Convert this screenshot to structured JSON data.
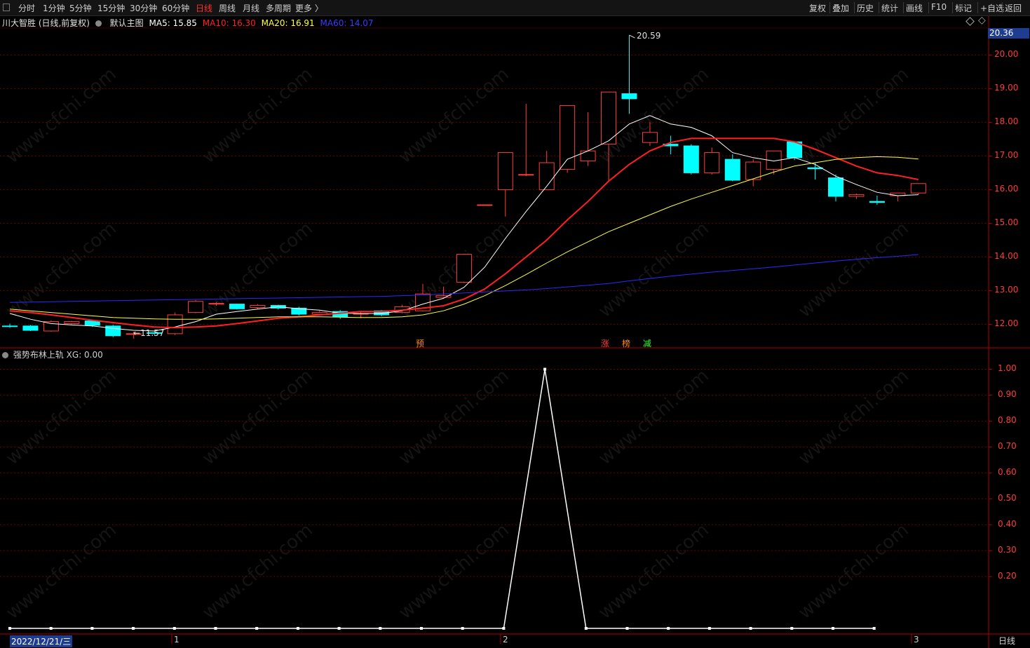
{
  "toolbar": {
    "periods": [
      "分时",
      "1分钟",
      "5分钟",
      "15分钟",
      "30分钟",
      "60分钟",
      "日线",
      "周线",
      "月线",
      "多周期",
      "更多 〉"
    ],
    "active": "日线",
    "right": [
      "复权",
      "叠加",
      "历史",
      "统计",
      "画线",
      "F10",
      "标记",
      "+自选",
      "返回"
    ]
  },
  "info": {
    "stock": "川大智胜 (日线,前复权)",
    "main_chart": "默认主图",
    "ma5": "MA5: 15.85",
    "ma10": "MA10: 16.30",
    "ma20": "MA20: 16.91",
    "ma60": "MA60: 14.07"
  },
  "indicator": {
    "name": "强势布林上轨",
    "xg": "XG: 0.00"
  },
  "price_tag": "20.36",
  "annotations": {
    "high": "20.59",
    "low": "11.57"
  },
  "tags": [
    "预",
    "涨",
    "榜",
    "减"
  ],
  "date_label": "2022/12/21/三",
  "period_label": "日线",
  "x_axis_labels": [
    "1",
    "2",
    "3"
  ],
  "watermark": "www.cfchi.com",
  "colors": {
    "up": "#ff3c3c",
    "down": "#00ffff",
    "ma5": "#ffffff",
    "ma10": "#ff2020",
    "ma20": "#ffff40",
    "ma60": "#2a2aff",
    "background": "#000000",
    "grid": "#7a0000"
  },
  "chart_data": [
    {
      "type": "candlestick",
      "title": "川大智胜 (日线,前复权)",
      "ylim": [
        11.3,
        20.8
      ],
      "yticks": [
        12.0,
        13.0,
        14.0,
        15.0,
        16.0,
        17.0,
        18.0,
        19.0,
        20.0
      ],
      "ytick_labels": [
        "12.00",
        "13.00",
        "14.00",
        "15.00",
        "16.00",
        "17.00",
        "18.00",
        "19.00",
        "20.00"
      ],
      "candles": [
        {
          "o": 11.95,
          "h": 12.02,
          "l": 11.9,
          "c": 11.93
        },
        {
          "o": 11.95,
          "h": 11.98,
          "l": 11.8,
          "c": 11.82
        },
        {
          "o": 11.8,
          "h": 12.12,
          "l": 11.78,
          "c": 12.08
        },
        {
          "o": 12.02,
          "h": 12.1,
          "l": 12.0,
          "c": 12.08
        },
        {
          "o": 12.1,
          "h": 12.12,
          "l": 11.92,
          "c": 11.97
        },
        {
          "o": 11.95,
          "h": 11.98,
          "l": 11.62,
          "c": 11.66
        },
        {
          "o": 11.72,
          "h": 11.78,
          "l": 11.57,
          "c": 11.72
        },
        {
          "o": 11.75,
          "h": 11.75,
          "l": 11.68,
          "c": 11.73
        },
        {
          "o": 11.72,
          "h": 12.35,
          "l": 11.68,
          "c": 12.28
        },
        {
          "o": 12.35,
          "h": 12.72,
          "l": 12.33,
          "c": 12.68
        },
        {
          "o": 12.62,
          "h": 12.66,
          "l": 12.55,
          "c": 12.62
        },
        {
          "o": 12.6,
          "h": 12.6,
          "l": 12.44,
          "c": 12.46
        },
        {
          "o": 12.5,
          "h": 12.6,
          "l": 12.46,
          "c": 12.56
        },
        {
          "o": 12.56,
          "h": 12.58,
          "l": 12.44,
          "c": 12.48
        },
        {
          "o": 12.48,
          "h": 12.52,
          "l": 12.26,
          "c": 12.3
        },
        {
          "o": 12.3,
          "h": 12.4,
          "l": 12.28,
          "c": 12.35
        },
        {
          "o": 12.38,
          "h": 12.42,
          "l": 12.16,
          "c": 12.22
        },
        {
          "o": 12.3,
          "h": 12.4,
          "l": 12.18,
          "c": 12.32
        },
        {
          "o": 12.4,
          "h": 12.42,
          "l": 12.24,
          "c": 12.28
        },
        {
          "o": 12.35,
          "h": 12.58,
          "l": 12.33,
          "c": 12.52
        },
        {
          "o": 12.4,
          "h": 13.2,
          "l": 12.38,
          "c": 12.9
        },
        {
          "o": 12.8,
          "h": 13.12,
          "l": 12.76,
          "c": 12.85
        },
        {
          "o": 13.25,
          "h": 14.1,
          "l": 13.22,
          "c": 14.08
        },
        {
          "o": 15.55,
          "h": 15.55,
          "l": 15.55,
          "c": 15.55
        },
        {
          "o": 16.0,
          "h": 17.1,
          "l": 15.2,
          "c": 17.1
        },
        {
          "o": 16.45,
          "h": 18.55,
          "l": 16.4,
          "c": 16.45
        },
        {
          "o": 16.0,
          "h": 17.15,
          "l": 16.0,
          "c": 16.8
        },
        {
          "o": 16.6,
          "h": 18.5,
          "l": 16.5,
          "c": 18.5
        },
        {
          "o": 16.85,
          "h": 18.3,
          "l": 16.7,
          "c": 17.15
        },
        {
          "o": 17.35,
          "h": 18.2,
          "l": 16.25,
          "c": 18.9
        },
        {
          "o": 18.85,
          "h": 20.59,
          "l": 18.25,
          "c": 18.7
        },
        {
          "o": 17.4,
          "h": 18.0,
          "l": 17.3,
          "c": 17.7
        },
        {
          "o": 17.35,
          "h": 17.6,
          "l": 17.05,
          "c": 17.3
        },
        {
          "o": 17.3,
          "h": 17.35,
          "l": 16.45,
          "c": 16.5
        },
        {
          "o": 16.5,
          "h": 17.25,
          "l": 16.45,
          "c": 17.1
        },
        {
          "o": 16.9,
          "h": 17.05,
          "l": 16.25,
          "c": 16.28
        },
        {
          "o": 16.3,
          "h": 16.9,
          "l": 16.1,
          "c": 16.82
        },
        {
          "o": 16.6,
          "h": 17.15,
          "l": 16.45,
          "c": 17.15
        },
        {
          "o": 17.42,
          "h": 17.42,
          "l": 16.88,
          "c": 16.95
        },
        {
          "o": 16.65,
          "h": 16.8,
          "l": 16.3,
          "c": 16.62
        },
        {
          "o": 16.35,
          "h": 16.45,
          "l": 15.65,
          "c": 15.8
        },
        {
          "o": 15.8,
          "h": 15.88,
          "l": 15.72,
          "c": 15.85
        },
        {
          "o": 15.65,
          "h": 15.82,
          "l": 15.55,
          "c": 15.62
        },
        {
          "o": 15.82,
          "h": 15.88,
          "l": 15.65,
          "c": 15.9
        },
        {
          "o": 15.9,
          "h": 16.18,
          "l": 15.85,
          "c": 16.18
        }
      ],
      "series": [
        {
          "name": "MA5",
          "values": [
            12.32,
            12.15,
            12.02,
            11.98,
            11.95,
            11.88,
            11.82,
            11.8,
            11.92,
            12.08,
            12.3,
            12.38,
            12.45,
            12.52,
            12.46,
            12.42,
            12.33,
            12.32,
            12.32,
            12.4,
            12.6,
            12.77,
            13.1,
            13.7,
            14.55,
            15.35,
            16.1,
            16.9,
            17.15,
            17.45,
            17.95,
            18.2,
            17.95,
            17.85,
            17.6,
            17.1,
            16.95,
            16.85,
            16.95,
            16.75,
            16.4,
            16.15,
            15.92,
            15.82,
            15.85
          ]
        },
        {
          "name": "MA10",
          "values": [
            12.4,
            12.35,
            12.28,
            12.2,
            12.12,
            12.05,
            11.98,
            11.92,
            11.9,
            11.92,
            11.95,
            12.02,
            12.1,
            12.18,
            12.22,
            12.28,
            12.33,
            12.38,
            12.38,
            12.42,
            12.48,
            12.55,
            12.75,
            13.05,
            13.5,
            14.0,
            14.5,
            15.1,
            15.65,
            16.25,
            16.75,
            17.15,
            17.4,
            17.52,
            17.52,
            17.52,
            17.52,
            17.52,
            17.42,
            17.2,
            16.95,
            16.7,
            16.5,
            16.42,
            16.3
          ]
        },
        {
          "name": "MA20",
          "values": [
            12.45,
            12.4,
            12.35,
            12.3,
            12.25,
            12.2,
            12.18,
            12.16,
            12.15,
            12.15,
            12.16,
            12.18,
            12.2,
            12.22,
            12.22,
            12.22,
            12.21,
            12.2,
            12.2,
            12.22,
            12.28,
            12.4,
            12.6,
            12.85,
            13.15,
            13.48,
            13.82,
            14.15,
            14.45,
            14.75,
            15.0,
            15.25,
            15.5,
            15.72,
            15.92,
            16.12,
            16.32,
            16.52,
            16.7,
            16.8,
            16.9,
            16.95,
            16.98,
            16.96,
            16.91
          ]
        },
        {
          "name": "MA60",
          "values": [
            12.65,
            12.66,
            12.67,
            12.68,
            12.69,
            12.7,
            12.71,
            12.72,
            12.73,
            12.74,
            12.75,
            12.76,
            12.77,
            12.78,
            12.79,
            12.8,
            12.81,
            12.82,
            12.83,
            12.85,
            12.87,
            12.9,
            12.93,
            12.96,
            12.99,
            13.02,
            13.06,
            13.11,
            13.16,
            13.21,
            13.29,
            13.36,
            13.43,
            13.49,
            13.55,
            13.6,
            13.65,
            13.7,
            13.76,
            13.82,
            13.88,
            13.93,
            13.98,
            14.02,
            14.07
          ]
        }
      ]
    },
    {
      "type": "line",
      "title": "强势布林上轨",
      "ylim": [
        0,
        1.05
      ],
      "yticks": [
        0.2,
        0.3,
        0.4,
        0.5,
        0.6,
        0.7,
        0.8,
        0.9,
        1.0
      ],
      "ytick_labels": [
        "0.20",
        "0.30",
        "0.40",
        "0.50",
        "0.60",
        "0.70",
        "0.80",
        "0.90",
        "1.00"
      ],
      "series": [
        {
          "name": "XG",
          "values": [
            0,
            0,
            0,
            0,
            0,
            0,
            0,
            0,
            0,
            0,
            0,
            0,
            0,
            1,
            0,
            0,
            0,
            0,
            0,
            0,
            0,
            0
          ]
        }
      ]
    }
  ]
}
